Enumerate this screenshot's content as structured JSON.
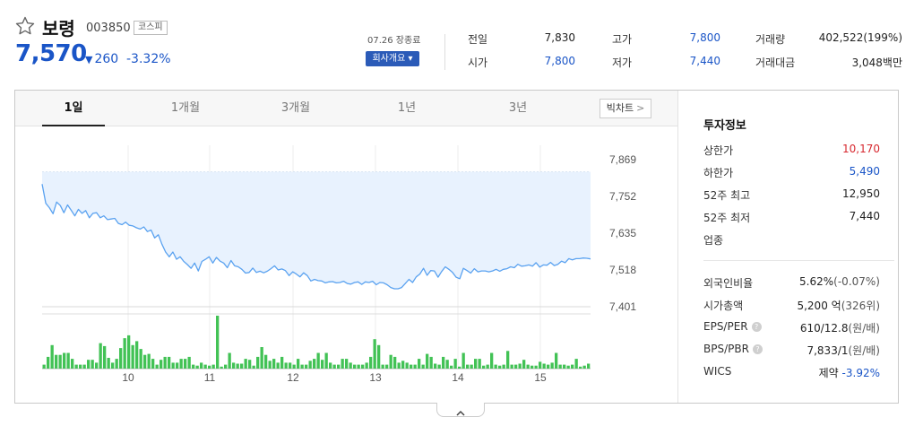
{
  "stock": {
    "name": "보령",
    "code": "003850",
    "market": "코스피",
    "price": "7,570",
    "change": "260",
    "change_pct": "-3.32%",
    "direction_icon": "down-triangle-icon",
    "favorite_icon": "star-outline-icon"
  },
  "header": {
    "close_time": "07.26 장종료",
    "company_button": "회사개요",
    "quotes": [
      {
        "label": "전일",
        "value": "7,830",
        "color": "normal"
      },
      {
        "label": "시가",
        "value": "7,800",
        "color": "blue"
      },
      {
        "label": "고가",
        "value": "7,800",
        "color": "blue"
      },
      {
        "label": "저가",
        "value": "7,440",
        "color": "blue"
      },
      {
        "label": "거래량",
        "value": "402,522(199%)",
        "color": "normal"
      },
      {
        "label": "거래대금",
        "value": "3,048백만",
        "color": "normal"
      }
    ]
  },
  "tabs": [
    "1일",
    "1개월",
    "3개월",
    "1년",
    "3년"
  ],
  "active_tab": "1일",
  "big_chart_button": "빅차트",
  "chart_data": {
    "type": "area",
    "y_ticks": [
      "7,869",
      "7,752",
      "7,635",
      "7,518",
      "7,401"
    ],
    "x_ticks": [
      "10",
      "11",
      "12",
      "13",
      "14",
      "15"
    ],
    "ylim": [
      7401,
      7869
    ],
    "previous_close_line": 7830,
    "price_series": [
      7791,
      7730,
      7716,
      7697,
      7734,
      7723,
      7700,
      7725,
      7708,
      7690,
      7711,
      7698,
      7707,
      7684,
      7698,
      7700,
      7684,
      7690,
      7678,
      7680,
      7682,
      7666,
      7662,
      7670,
      7660,
      7658,
      7652,
      7648,
      7655,
      7640,
      7645,
      7620,
      7630,
      7600,
      7575,
      7560,
      7575,
      7552,
      7560,
      7545,
      7535,
      7523,
      7540,
      7515,
      7545,
      7552,
      7560,
      7540,
      7558,
      7546,
      7540,
      7525,
      7548,
      7531,
      7528,
      7520,
      7508,
      7510,
      7524,
      7510,
      7514,
      7509,
      7514,
      7522,
      7531,
      7518,
      7521,
      7516,
      7500,
      7512,
      7505,
      7496,
      7509,
      7500,
      7483,
      7488,
      7484,
      7483,
      7477,
      7480,
      7481,
      7477,
      7478,
      7482,
      7475,
      7473,
      7478,
      7480,
      7472,
      7480,
      7478,
      7482,
      7471,
      7478,
      7477,
      7471,
      7462,
      7458,
      7458,
      7462,
      7475,
      7488,
      7478,
      7496,
      7505,
      7523,
      7501,
      7516,
      7515,
      7495,
      7513,
      7528,
      7520,
      7510,
      7495,
      7490,
      7523,
      7516,
      7508,
      7522,
      7512,
      7515,
      7515,
      7512,
      7515,
      7520,
      7514,
      7520,
      7522,
      7528,
      7525,
      7536,
      7530,
      7531,
      7534,
      7530,
      7541,
      7527,
      7534,
      7533,
      7542,
      7532,
      7536,
      7546,
      7541,
      7554,
      7550,
      7554,
      7554,
      7556,
      7555,
      7553
    ],
    "volume_series": [
      4,
      12,
      24,
      14,
      14,
      16,
      16,
      10,
      4,
      4,
      4,
      9,
      9,
      6,
      26,
      23,
      11,
      6,
      10,
      21,
      31,
      34,
      24,
      28,
      20,
      14,
      15,
      10,
      4,
      9,
      12,
      12,
      6,
      6,
      10,
      10,
      12,
      4,
      3,
      6,
      4,
      3,
      4,
      54,
      2,
      4,
      16,
      6,
      5,
      5,
      10,
      9,
      3,
      12,
      22,
      14,
      8,
      10,
      6,
      12,
      6,
      6,
      4,
      10,
      4,
      4,
      8,
      10,
      16,
      9,
      16,
      6,
      4,
      4,
      10,
      10,
      6,
      4,
      4,
      4,
      6,
      12,
      30,
      24,
      4,
      4,
      14,
      12,
      6,
      8,
      6,
      4,
      4,
      10,
      4,
      15,
      12,
      5,
      4,
      12,
      9,
      3,
      10,
      2,
      16,
      4,
      4,
      10,
      10,
      3,
      4,
      16,
      4,
      3,
      4,
      18,
      4,
      4,
      5,
      9,
      4,
      3,
      3,
      7,
      5,
      4,
      6,
      16,
      4,
      4,
      3,
      4,
      10,
      2,
      3,
      5
    ]
  },
  "side": {
    "title": "투자정보",
    "top_rows": [
      {
        "label": "상한가",
        "value": "10,170",
        "color": "red"
      },
      {
        "label": "하한가",
        "value": "5,490",
        "color": "blue"
      },
      {
        "label": "52주 최고",
        "value": "12,950",
        "color": "normal"
      },
      {
        "label": "52주 최저",
        "value": "7,440",
        "color": "normal"
      },
      {
        "label": "업종",
        "value": "",
        "color": "normal"
      }
    ],
    "bottom_rows": [
      {
        "label": "외국인비율",
        "value": "5.62%",
        "sub": "(-0.07%)",
        "help": false
      },
      {
        "label": "시가총액",
        "value": "5,200 억",
        "sub": "(326위)",
        "help": false
      },
      {
        "label": "EPS/PER",
        "value": "610/12.8",
        "sub": "(원/배)",
        "help": true
      },
      {
        "label": "BPS/PBR",
        "value": "7,833/1",
        "sub": "(원/배)",
        "help": true
      },
      {
        "label": "WICS",
        "value": "제약",
        "sub": "-3.92%",
        "help": false
      }
    ],
    "help_icon_text": "?"
  },
  "expand_icon": "chevron-up-icon",
  "colors": {
    "accent_blue": "#1a55c7",
    "up_red": "#d7282f",
    "line_blue": "#5aa2f0",
    "fill_blue": "#e8f2fe",
    "volume_green": "#42c255"
  }
}
